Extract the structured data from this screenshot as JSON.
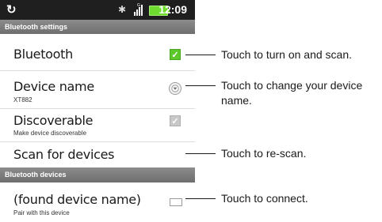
{
  "status_bar": {
    "sync_icon": "sync-icon",
    "bluetooth_icon": "bluetooth-icon",
    "signal_icon": "signal-icon",
    "battery_icon": "battery-icon",
    "time": "12:09"
  },
  "bluetooth_settings": {
    "header": "Bluetooth settings",
    "bluetooth": {
      "title": "Bluetooth",
      "checked": true
    },
    "device_name": {
      "title": "Device name",
      "value": "XT882"
    },
    "discoverable": {
      "title": "Discoverable",
      "subtitle": "Make device discoverable",
      "checked": true
    },
    "scan": {
      "title": "Scan for devices"
    }
  },
  "bluetooth_devices": {
    "header": "Bluetooth devices",
    "found_device": {
      "title": "(found device name)",
      "subtitle": "Pair with this device"
    }
  },
  "callouts": {
    "turn_on": "Touch to turn on and scan.",
    "change_name_line1": "Touch to change your device",
    "change_name_line2": "name.",
    "rescan": "Touch to re-scan.",
    "connect": "Touch to connect."
  },
  "colors": {
    "status_bar": "#1f1f1f",
    "section_header": "#7d7d7d",
    "checkbox_on": "#5cc82c",
    "checkbox_disabled": "#c8c8c8",
    "battery": "#6edc2f"
  }
}
